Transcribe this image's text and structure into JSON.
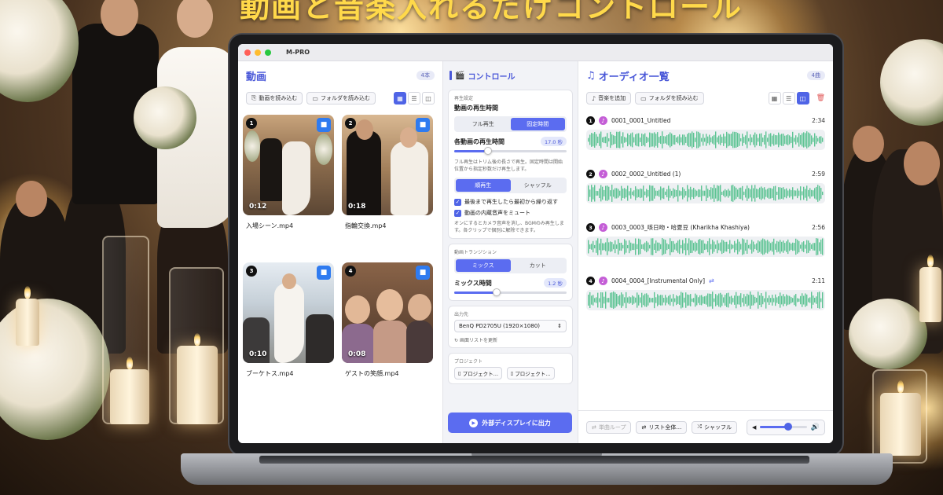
{
  "headline": "動画と音楽入れるだけコントロール",
  "app": {
    "title": "M-PRO"
  },
  "video_pane": {
    "title": "動画",
    "count": "4本",
    "buttons": {
      "load_video": "動画を読み込む",
      "load_folder": "フォルダを読み込む"
    },
    "videos": [
      {
        "num": "1",
        "duration": "0:12",
        "name": "入場シーン.mp4"
      },
      {
        "num": "2",
        "duration": "0:18",
        "name": "指輪交換.mp4"
      },
      {
        "num": "3",
        "duration": "0:10",
        "name": "ブーケトス.mp4"
      },
      {
        "num": "4",
        "duration": "0:08",
        "name": "ゲストの笑顔.mp4"
      }
    ]
  },
  "control_pane": {
    "title": "コントロール",
    "playback": {
      "label": "再生設定",
      "title": "動画の再生時間",
      "modes": [
        "フル再生",
        "固定時間"
      ],
      "active_mode": 1,
      "duration_label": "各動画の再生時間",
      "duration_value": "17.0 秒",
      "duration_fraction": 0.3,
      "note": "フル再生はトリム後の長さで再生。固定時間は開始位置から指定秒数だけ再生します。",
      "order": [
        "順再生",
        "シャッフル"
      ],
      "active_order": 0,
      "check1": "最後まで再生したら最初から繰り返す",
      "check2": "動画の内蔵音声をミュート",
      "note2": "オンにするとカメラ音声を消し、BGMのみ再生します。各クリップで個別に解除できます。"
    },
    "transition": {
      "label": "動画トランジション",
      "modes": [
        "ミックス",
        "カット"
      ],
      "active_mode": 0,
      "mix_label": "ミックス時間",
      "mix_value": "1.2 秒",
      "mix_fraction": 0.38
    },
    "output": {
      "label": "出力先",
      "display": "BenQ PD2705U (1920×1080)",
      "refresh": "画面リストを更新"
    },
    "project": {
      "label": "プロジェクト",
      "btn1": "プロジェクト…",
      "btn2": "プロジェクト…"
    },
    "output_button": "外部ディスプレイに出力"
  },
  "audio_pane": {
    "title": "オーディオ一覧",
    "count": "4曲",
    "buttons": {
      "add_music": "音楽を追加",
      "load_folder": "フォルダを読み込む"
    },
    "tracks": [
      {
        "num": "1",
        "name": "0001_0001_Untitled",
        "duration": "2:34"
      },
      {
        "num": "2",
        "name": "0002_0002_Untitled (1)",
        "duration": "2:59"
      },
      {
        "num": "3",
        "name": "0003_0003_咳日吻・哈夏豆 (Kharikha Khashiya)",
        "duration": "2:56"
      },
      {
        "num": "4",
        "name": "0004_0004_[Instrumental Only]",
        "duration": "2:11"
      }
    ],
    "footer": {
      "single_loop": "単曲ループ",
      "list_all": "リスト全体…",
      "shuffle": "シャッフル"
    },
    "volume": 0.6,
    "wave_color": "#5ec494"
  }
}
